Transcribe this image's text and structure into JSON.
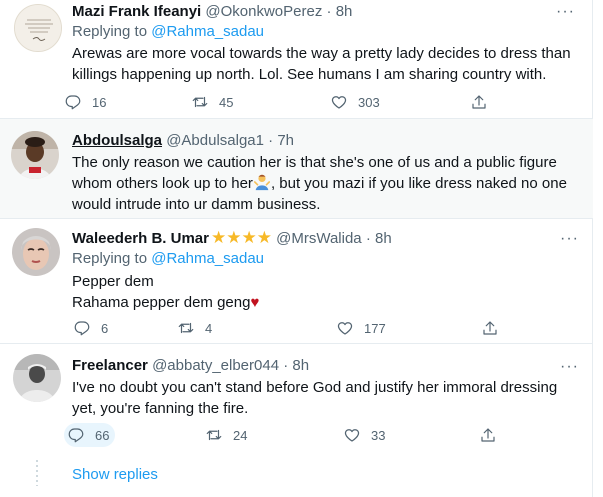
{
  "tweets": [
    {
      "name": "Mazi Frank Ifeanyi",
      "handle": "@OkonkwoPerez",
      "time": "8h",
      "reply_prefix": "Replying to",
      "reply_to": "@Rahma_sadau",
      "text": "Arewas are more vocal towards the way a pretty lady decides to dress than killings happening up north. Lol. See humans I am sharing country with.",
      "replies": "16",
      "retweets": "45",
      "likes": "303"
    },
    {
      "name": "Abdoulsalga",
      "handle": "@Abdulsalga1",
      "time": "7h",
      "text_before_emoji": "The only reason we caution her  is that she's one of us and a public figure whom others look up to her",
      "text_after_emoji": ", but you mazi if you like dress naked no one would intrude into ur damm business."
    },
    {
      "name": "Waleederh B. Umar",
      "stars": "★★★★",
      "handle": "@MrsWalida",
      "time": "8h",
      "reply_prefix": "Replying to",
      "reply_to": "@Rahma_sadau",
      "line1": "Pepper dem",
      "line2": "Rahama pepper dem geng",
      "heart": "♥",
      "replies": "6",
      "retweets": "4",
      "likes": "177"
    },
    {
      "name": "Freelancer",
      "handle": "@abbaty_elber044",
      "time": "8h",
      "text": "I've no doubt you can't stand before God and justify her immoral dressing yet, you're fanning the fire.",
      "replies": "66",
      "retweets": "24",
      "likes": "33"
    }
  ],
  "separator": "·",
  "more_glyph": "···",
  "show_replies": "Show replies",
  "colors": {
    "accent": "#1d9bf0",
    "secondary_text": "#536471",
    "divider": "#e6ecf0",
    "star": "#f7b928",
    "heart": "#c1121f"
  },
  "icons": [
    "reply-icon",
    "retweet-icon",
    "like-icon",
    "share-icon",
    "more-icon"
  ]
}
